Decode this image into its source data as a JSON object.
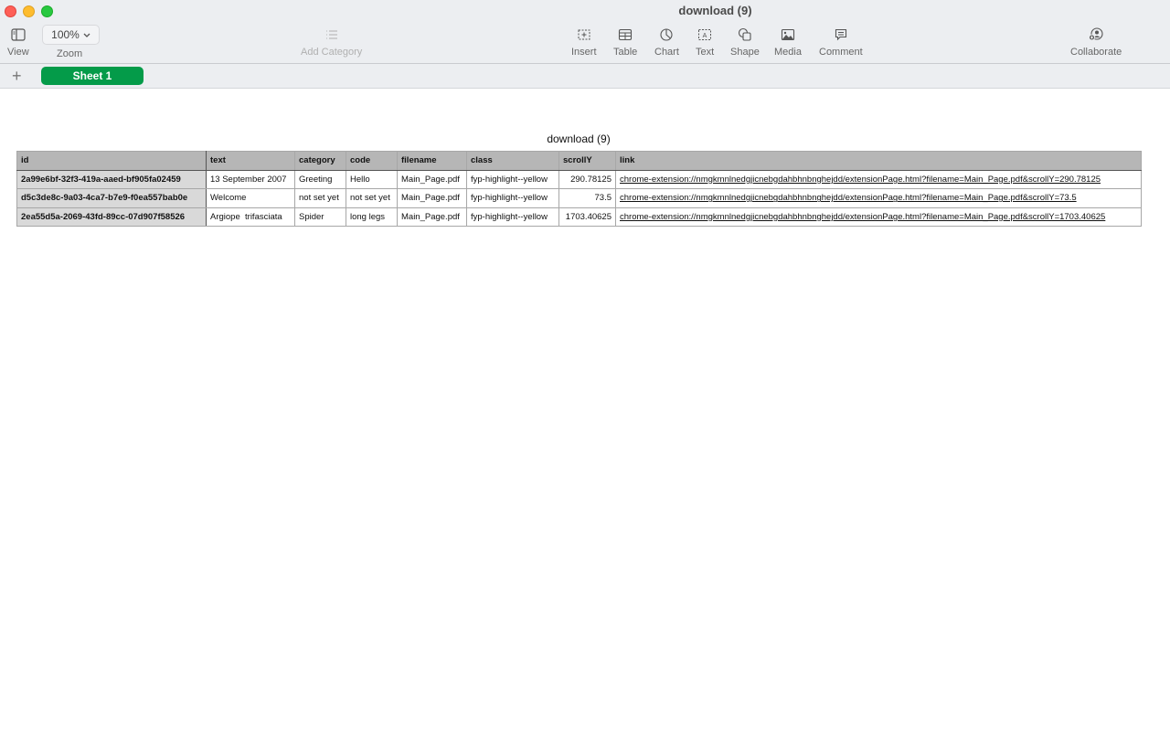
{
  "window": {
    "title": "download (9)"
  },
  "toolbar": {
    "view_label": "View",
    "zoom_value": "100%",
    "zoom_label": "Zoom",
    "add_category_label": "Add Category",
    "insert_label": "Insert",
    "table_label": "Table",
    "chart_label": "Chart",
    "text_label": "Text",
    "shape_label": "Shape",
    "media_label": "Media",
    "comment_label": "Comment",
    "collaborate_label": "Collaborate"
  },
  "sheets": {
    "add_label": "+",
    "tabs": [
      {
        "label": "Sheet 1",
        "active": true
      }
    ]
  },
  "table": {
    "title": "download (9)",
    "columns": [
      "id",
      "text",
      "category",
      "code",
      "filename",
      "class",
      "scrollY",
      "link"
    ],
    "rows": [
      {
        "id": "2a99e6bf-32f3-419a-aaed-bf905fa02459",
        "text": "13 September 2007",
        "category": "Greeting",
        "code": "Hello",
        "filename": "Main_Page.pdf",
        "class": "fyp-highlight--yellow",
        "scrollY": "290.78125",
        "link": "chrome-extension://nmgkmnlnedgjicnebgdahbhnbnghejdd/extensionPage.html?filename=Main_Page.pdf&scrollY=290.78125"
      },
      {
        "id": "d5c3de8c-9a03-4ca7-b7e9-f0ea557bab0e",
        "text": "Welcome",
        "category": "not set yet",
        "code": "not set yet",
        "filename": "Main_Page.pdf",
        "class": "fyp-highlight--yellow",
        "scrollY": "73.5",
        "link": "chrome-extension://nmgkmnlnedgjicnebgdahbhnbnghejdd/extensionPage.html?filename=Main_Page.pdf&scrollY=73.5"
      },
      {
        "id": "2ea55d5a-2069-43fd-89cc-07d907f58526",
        "text": "Argiope  trifasciata",
        "category": "Spider",
        "code": "long legs",
        "filename": "Main_Page.pdf",
        "class": "fyp-highlight--yellow",
        "scrollY": "1703.40625",
        "link": "chrome-extension://nmgkmnlnedgjicnebgdahbhnbnghejdd/extensionPage.html?filename=Main_Page.pdf&scrollY=1703.40625"
      }
    ]
  },
  "colors": {
    "sheet_tab_active": "#049b49",
    "header_bg": "#b6b6b6",
    "id_col_bg": "#d9d9d9"
  }
}
